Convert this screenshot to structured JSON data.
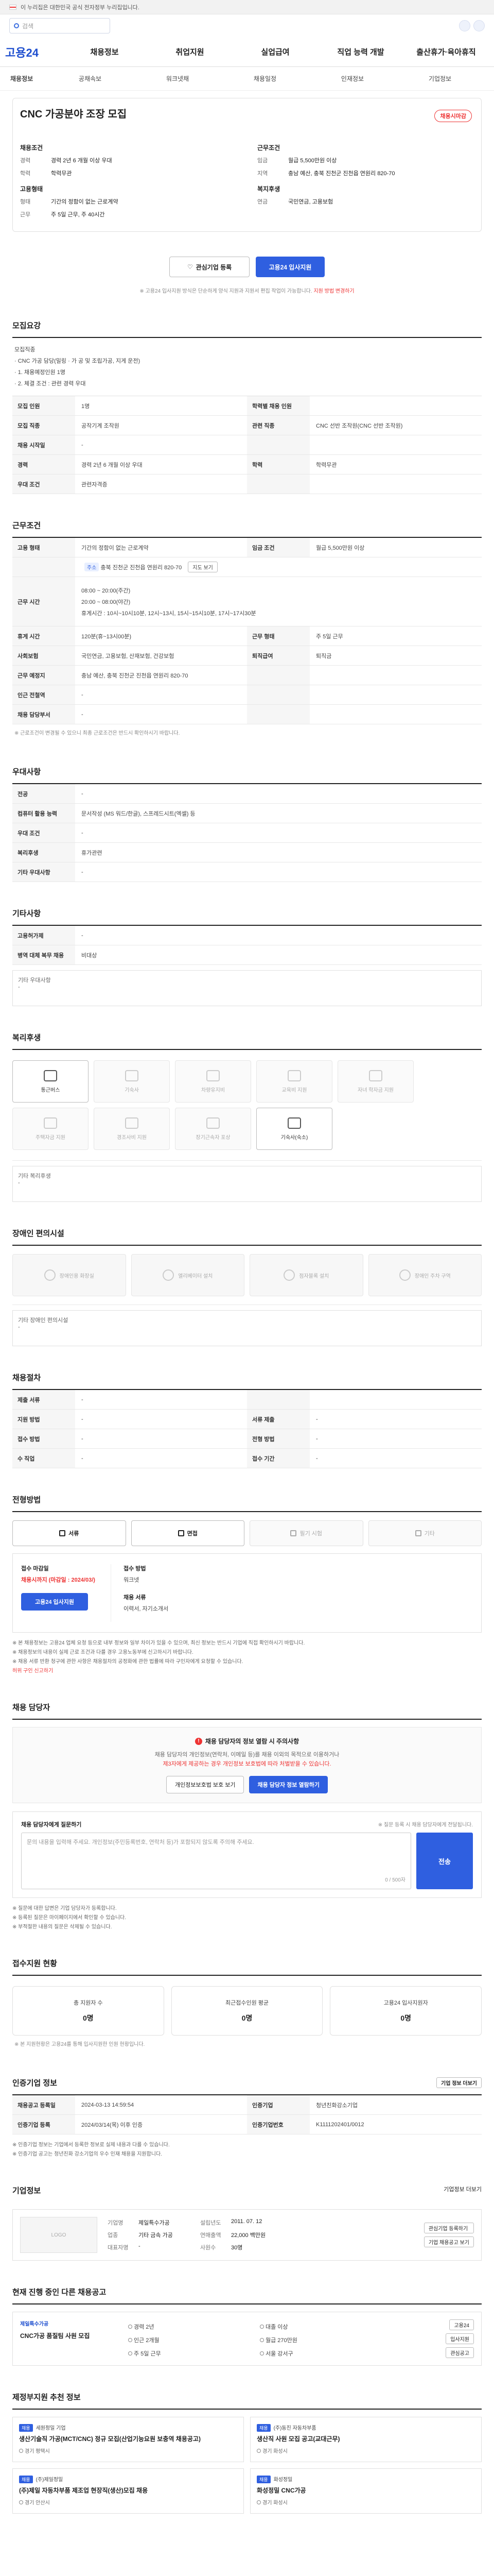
{
  "gov_banner": {
    "text": "이 누리집은 대한민국 공식 전자정부 누리집입니다."
  },
  "top": {
    "search_placeholder": "검색"
  },
  "gnb": {
    "logo": "고용24",
    "items": [
      "채용정보",
      "취업지원",
      "실업급여",
      "직업 능력 개발",
      "출산휴가·육아휴직"
    ]
  },
  "subnav": {
    "first": "채용정보",
    "items": [
      "공채속보",
      "워크넷채",
      "채용일정",
      "인재정보",
      "기업정보"
    ]
  },
  "job": {
    "title": "CNC 가공분야 조장 모집",
    "status": "채용시마감",
    "labels": {
      "recruit": "채용조건",
      "conditions": "근무조건",
      "employ": "고용형태",
      "welfare": "복지후생"
    },
    "recruit_rows": [
      {
        "k": "경력",
        "v": "경력 2년 6 개월 이상 우대"
      },
      {
        "k": "학력",
        "v": "학력무관"
      }
    ],
    "cond_rows": [
      {
        "k": "임금",
        "v": "월급 5,500만원 이상"
      },
      {
        "k": "지역",
        "v": "충남 예산, 충북 진천군 진천읍 연원리 820-70"
      }
    ],
    "employ_rows": [
      {
        "k": "형태",
        "v": "기간의 정함이 없는 근로계약"
      },
      {
        "k": "근무",
        "v": "주 5일 근무, 주 40시간"
      }
    ],
    "welfare_rows": [
      {
        "k": "연금",
        "v": "국민연금, 고용보험"
      }
    ],
    "btn_interest": "관심기업 등록",
    "btn_apply": "고용24 입사지원",
    "note": "※ 고용24 입사지원 방식은 단순하게 양식 지원과 지원서 편집 작업이 가능합니다.",
    "note_red": "지원 방법 변경하기"
  },
  "summary": {
    "heading": "모집요강",
    "desc_lines": [
      "모집직종",
      "· CNC 가공 담당(밀링 · 가 공 및 조립가공, 지게 운전)",
      "· 1. 채용예정인원 1명",
      "· 2. 체결 조건 : 관련 경력 우대"
    ],
    "rows": [
      {
        "k": "모집 인원",
        "v": "1명",
        "k2": "학력별 채용 인원",
        "v2": ""
      },
      {
        "k": "모집 직종",
        "v": "공작기계 조작원",
        "k2": "관련 직종",
        "v2": "CNC 선반 조작원(CNC 선반 조작원)"
      },
      {
        "k": "채용 시작일",
        "v": "-",
        "k2": "",
        "v2": ""
      },
      {
        "k": "경력",
        "v": "경력 2년 6 개월 이상 우대",
        "k2": "학력",
        "v2": "학력무관"
      },
      {
        "k": "우대 조건",
        "v": "관련자격증",
        "k2": "",
        "v2": ""
      }
    ]
  },
  "work": {
    "heading": "근무조건",
    "rows1": [
      {
        "k": "고용 형태",
        "v": "기간의 정함이 없는 근로계약",
        "k2": "임금 조건",
        "v2": "월급 5,500만원 이상"
      }
    ],
    "addr_tag": "주소",
    "address": "충북 진천군 진천읍 연원리 820-70",
    "map_btn": "지도 보기",
    "hours_label": "근무 시간",
    "hours": [
      "08:00 ~ 20:00(주간)",
      "20:00 ~ 08:00(야간)",
      "휴게시간 : 10시~10시10분, 12시~13시, 15시~15시10분, 17시~17시30분"
    ],
    "rows2": [
      {
        "k": "휴게 시간",
        "v": "120분(휴~13시00분)",
        "k2": "근무 형태",
        "v2": "주 5일 근무"
      },
      {
        "k": "사회보험",
        "v": "국민연금, 고용보험, 산재보험, 건강보험",
        "k2": "퇴직급여",
        "v2": "퇴직금"
      },
      {
        "k": "근무 예정지",
        "v": "충남 예산, 충북 진천군 진천읍 연원리 820-70",
        "k2": "",
        "v2": ""
      },
      {
        "k": "인근 전철역",
        "v": "-",
        "k2": "",
        "v2": ""
      },
      {
        "k": "채용 담당부서",
        "v": "-",
        "k2": "",
        "v2": ""
      }
    ],
    "note": "※ 근로조건이 변경될 수 있으니 최종 근로조건은 반드시 확인하시기 바랍니다."
  },
  "welfare": {
    "heading": "우대사항",
    "rows": [
      {
        "k": "전공",
        "v": "-"
      },
      {
        "k": "컴퓨터 활용 능력",
        "v": "문서작성 (MS 워드/한글), 스프레드시트(엑셀) 등"
      },
      {
        "k": "우대 조건",
        "v": "-"
      },
      {
        "k": "복리후생",
        "v": "휴가관련"
      },
      {
        "k": "기타 우대사항",
        "v": "-"
      }
    ]
  },
  "extra": {
    "heading": "기타사항",
    "rows": [
      {
        "k": "고용허가제",
        "v": "-"
      },
      {
        "k": "병역 대체 복무 채용",
        "v": "비대상"
      }
    ],
    "box_label": "기타 우대사항",
    "box_value": "-"
  },
  "benefits": {
    "heading": "복리후생",
    "cards": [
      {
        "name": "통근버스",
        "on": true
      },
      {
        "name": "기숙사",
        "on": false
      },
      {
        "name": "차량유지비",
        "on": false
      },
      {
        "name": "교육비 지원",
        "on": false
      },
      {
        "name": "자녀 학자금 지원",
        "on": false
      },
      {
        "name": "주택자금 지원",
        "on": false
      },
      {
        "name": "경조사비 지원",
        "on": false
      },
      {
        "name": "장기근속자 포상",
        "on": false
      },
      {
        "name": "기숙사(숙소)",
        "on": true
      }
    ],
    "box_label": "기타 복리후생",
    "box_value": "-"
  },
  "disability": {
    "heading": "장애인 편의시설",
    "cards": [
      "장애인용 화장실",
      "엘리베이터 설치",
      "점자블록 설치",
      "장애인 주차 구역"
    ],
    "box_label": "기타 장애인 편의시설",
    "box_value": "-"
  },
  "process": {
    "heading": "채용절차",
    "rows": [
      {
        "k": "제출 서류",
        "v": "-",
        "k2": "",
        "v2": ""
      },
      {
        "k": "지원 방법",
        "v": "-",
        "k2": "서류 제출",
        "v2": "-"
      },
      {
        "k": "접수 방법",
        "v": "-",
        "k2": "전형 방법",
        "v2": "-"
      },
      {
        "k": "수 직업",
        "v": "-",
        "k2": "접수 기간",
        "v2": "-"
      }
    ]
  },
  "apply": {
    "heading": "전형방법",
    "tabs": [
      {
        "name": "서류",
        "on": true
      },
      {
        "name": "면접",
        "on": true
      },
      {
        "name": "필기 시험",
        "on": false
      },
      {
        "name": "기타",
        "on": false
      }
    ],
    "left_label": "접수 마감일",
    "left_value": "채용시까지 (마감일 : 2024/03/)",
    "btn": "고용24 입사지원",
    "right_label1": "접수 방법",
    "right_value1": "워크넷",
    "right_label2": "채용 서류",
    "right_value2": "이력서, 자기소개서",
    "notes": [
      "※ 본 채용정보는 고용24 업체 요청 등으로 내부 정보와 일부 차이가 있을 수 있으며, 최신 정보는 반드시 기업에 직접 확인하시기 바랍니다.",
      "※ 채용정보의 내용이 실제 근로 조건과 다를 경우 고용노동부에 신고하시기 바랍니다.",
      "※ 채용 서류 반환 청구에 관한 사항은 채용절차의 공정화에 관한 법률에 따라 구인자에게 요청할 수 있습니다."
    ],
    "notes_red": "허위 구인 신고하기"
  },
  "contact": {
    "heading": "채용 담당자",
    "alert_title": "채용 담당자의 정보 열람 시 주의사항",
    "alert_sub1": "채용 담당자의 개인정보(연락처, 이메일 등)를 채용 이외의 목적으로 이용하거나",
    "alert_sub2": "제3자에게 제공하는 경우 개인정보 보호법에 따라 처벌받을 수 있습니다.",
    "btn1": "개인정보보호법 보호 보기",
    "btn2": "채용 담당자 정보 열람하기",
    "inq_label": "채용 담당자에게 질문하기",
    "inq_hint": "※ 질문 등록 시 채용 담당자에게 전달됩니다.",
    "inq_placeholder": "문의 내용을 입력해 주세요. 개인정보(주민등록번호, 연락처 등)가 포함되지 않도록 주의해 주세요.",
    "inq_count": "0 / 500자",
    "inq_btn": "전송",
    "notes": [
      "※ 질문에 대한 답변은 기업 담당자가 등록합니다.",
      "※ 등록된 질문은 마이페이지에서 확인할 수 있습니다.",
      "※ 부적절한 내용의 질문은 삭제될 수 있습니다."
    ]
  },
  "status": {
    "heading": "접수지원 현황",
    "cards": [
      {
        "lbl": "총 지원자 수",
        "val": "0명"
      },
      {
        "lbl": "최근접수인원 평균",
        "val": "0명"
      },
      {
        "lbl": "고용24 입사지원자",
        "val": "0명"
      }
    ],
    "note": "※ 본 지원현황은 고용24를 통해 입사지원한 인원 현황입니다."
  },
  "mgmt": {
    "heading": "인증기업 정보",
    "btn": "기업 정보 더보기",
    "rows": [
      {
        "k": "채용공고 등록일",
        "v": "2024-03-13 14:59:54",
        "k2": "인증기업",
        "v2": "청년친화강소기업"
      },
      {
        "k": "인증기업 등록",
        "v": "2024/03/14(목) 이후 인증",
        "k2": "인증기업번호",
        "v2": "K1111202401/0012"
      }
    ],
    "notes": [
      "※ 인증기업 정보는 기업에서 등록한 정보로 실제 내용과 다를 수 있습니다.",
      "※ 인증기업 공고는 청년친화 강소기업의 우수 인재 채용을 지원합니다."
    ]
  },
  "company": {
    "heading": "기업정보",
    "more": "기업정보 더보기",
    "logo_text": "LOGO",
    "info": [
      {
        "k": "기업명",
        "v": "제일특수가공"
      },
      {
        "k": "설립년도",
        "v": "2011. 07. 12"
      },
      {
        "k": "업종",
        "v": "기타 금속 가공"
      },
      {
        "k": "연매출액",
        "v": "22,000 백만원"
      },
      {
        "k": "대표자명",
        "v": "-"
      },
      {
        "k": "사원수",
        "v": "30명"
      }
    ],
    "btn1": "관심기업 등록하기",
    "btn2": "기업 채용공고 보기"
  },
  "others": {
    "heading": "현재 진행 중인 다른 채용공고",
    "logo": "제일특수가공",
    "title": "CNC가공 품질팀 사원 모집",
    "meta": [
      "경력 2년",
      "대졸 이상",
      "인근 2개월",
      "월급 270만원",
      "주 5일 근무",
      "서울 강서구"
    ],
    "btn1": "고용24",
    "btn2": "입사지원",
    "btn3": "관심공고"
  },
  "recommended": {
    "heading": "제정부지원 추천 정보",
    "cards": [
      {
        "badge": "채용",
        "co": "세원정밀 기업",
        "title": "생산기술직 가공(MCT/CNC) 정규 모집(산업기능요원 보충역 채용공고)",
        "meta": "경기 평택시"
      },
      {
        "badge": "채용",
        "co": "(주)동진 자동차부품",
        "title": "생산직 사원 모집 공고(교대근무)",
        "meta": "경기 화성시"
      },
      {
        "badge": "채용",
        "co": "(주)제일정밀",
        "title": "(주)제일 자동차부품 제조업 현장직(생산)모집 채용",
        "meta": "경기 안산시"
      },
      {
        "badge": "채용",
        "co": "화성정밀",
        "title": "화성정밀 CNC가공",
        "meta": "경기 화성시"
      }
    ]
  }
}
